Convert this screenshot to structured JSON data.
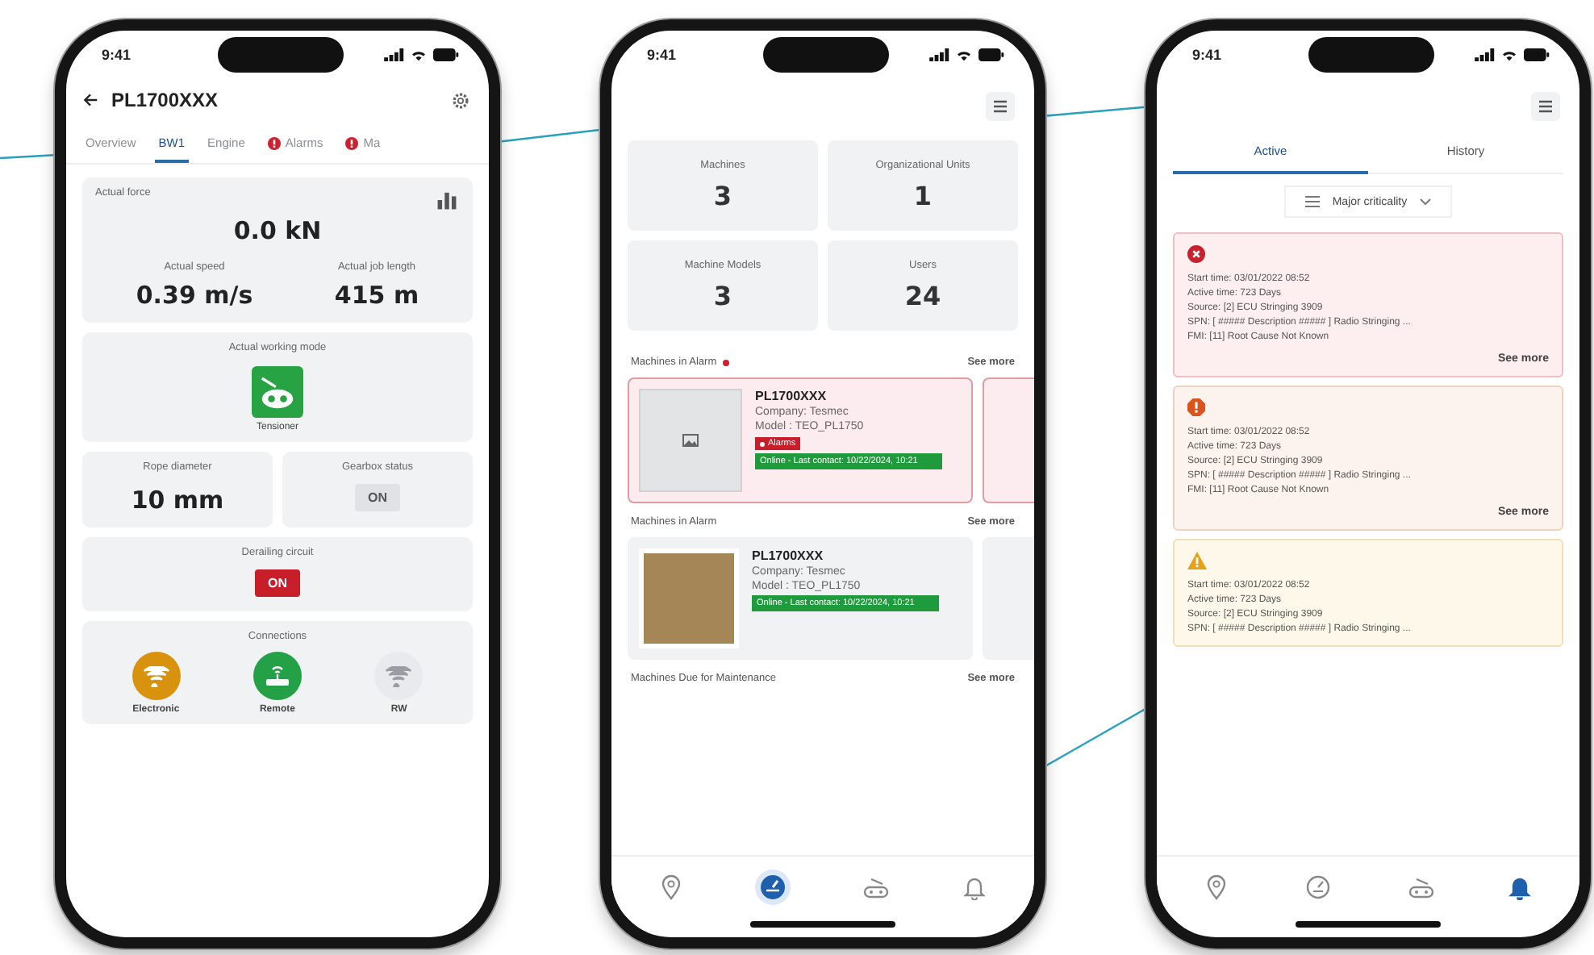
{
  "phones": [
    {
      "kind": "machine_detail",
      "status_time": "9:41",
      "title": "PL1700XXX",
      "tabs": [
        {
          "label": "Overview",
          "selected": false,
          "alert": false
        },
        {
          "label": "BW1",
          "selected": true,
          "alert": false
        },
        {
          "label": "Engine",
          "selected": false,
          "alert": false
        },
        {
          "label": "Alarms",
          "selected": false,
          "alert": true
        },
        {
          "label": "Ma",
          "selected": false,
          "alert": true
        }
      ],
      "force": {
        "label": "Actual force",
        "value": "0.0 kN"
      },
      "metrics": [
        {
          "label": "Actual speed",
          "value": "0.39 m/s"
        },
        {
          "label": "Actual job length",
          "value": "415 m"
        }
      ],
      "working_mode": {
        "label": "Actual working mode",
        "mode": "Tensioner"
      },
      "rope": {
        "label": "Rope diameter",
        "value": "10 mm"
      },
      "gearbox": {
        "label": "Gearbox status",
        "badge": "ON",
        "alarm": false
      },
      "circuit": {
        "label": "Derailing circuit",
        "badge": "ON",
        "alarm": true
      },
      "connections": {
        "title": "Connections",
        "items": [
          {
            "label": "Electronic",
            "kind": "wifi",
            "color": "#d8920e"
          },
          {
            "label": "Remote",
            "kind": "remote",
            "color": "#24a046"
          },
          {
            "label": "RW",
            "kind": "wifi",
            "color": "#e8eaed"
          }
        ]
      }
    },
    {
      "kind": "dashboard",
      "status_time": "9:41",
      "stats": [
        {
          "label": "Machines",
          "value": "3"
        },
        {
          "label": "Organizational Units",
          "value": "1"
        },
        {
          "label": "Machine Models",
          "value": "3"
        },
        {
          "label": "Users",
          "value": "24"
        }
      ],
      "sections": [
        {
          "title": "Machines in Alarm",
          "alert": true,
          "link": "See more",
          "peek": true,
          "machines": [
            {
              "name": "PL1700XXX",
              "company": "Company: Tesmec",
              "model": "Model : TEO_PL1750",
              "photo": false,
              "alarm_badge": "Alarms",
              "status": "Online - Last contact: 10/22/2024, 10:21"
            }
          ]
        },
        {
          "title": "Machines in Alarm",
          "alert": false,
          "link": "See more",
          "peek": true,
          "machines": [
            {
              "name": "PL1700XXX",
              "company": "Company: Tesmec",
              "model": "Model : TEO_PL1750",
              "photo": true,
              "status": "Online - Last contact: 10/22/2024, 10:21"
            }
          ]
        },
        {
          "title": "Machines Due for Maintenance",
          "alert": false,
          "link": "See more"
        }
      ],
      "nav": [
        {
          "kind": "map",
          "selected": false
        },
        {
          "kind": "dashboard",
          "selected": true
        },
        {
          "kind": "machine",
          "selected": false
        },
        {
          "kind": "bell",
          "selected": false
        }
      ]
    },
    {
      "kind": "alarms",
      "status_time": "9:41",
      "tabs": [
        {
          "label": "Active",
          "selected": true
        },
        {
          "label": "History",
          "selected": false
        }
      ],
      "filter": "Major criticality",
      "alarms": [
        {
          "kind": "critical",
          "link": "See more",
          "lines": [
            "Start time: 03/01/2022 08:52",
            "Active time: 723 Days",
            "Source: [2] ECU Stringing 3909",
            "SPN: [ ##### Description ##### ] Radio Stringing ...",
            "FMI: [11] Root Cause Not Known"
          ]
        },
        {
          "kind": "major",
          "link": "See more",
          "lines": [
            "Start time: 03/01/2022 08:52",
            "Active time: 723 Days",
            "Source: [2] ECU Stringing 3909",
            "SPN: [ ##### Description ##### ] Radio Stringing ...",
            "FMI: [11] Root Cause Not Known"
          ]
        },
        {
          "kind": "warning",
          "lines": [
            "Start time: 03/01/2022 08:52",
            "Active time: 723 Days",
            "Source: [2] ECU Stringing 3909",
            "SPN: [ ##### Description ##### ] Radio Stringing ..."
          ]
        }
      ],
      "nav": [
        {
          "kind": "map",
          "selected": false
        },
        {
          "kind": "dashboard",
          "selected": false
        },
        {
          "kind": "machine",
          "selected": false
        },
        {
          "kind": "bell",
          "selected": true
        }
      ]
    }
  ]
}
